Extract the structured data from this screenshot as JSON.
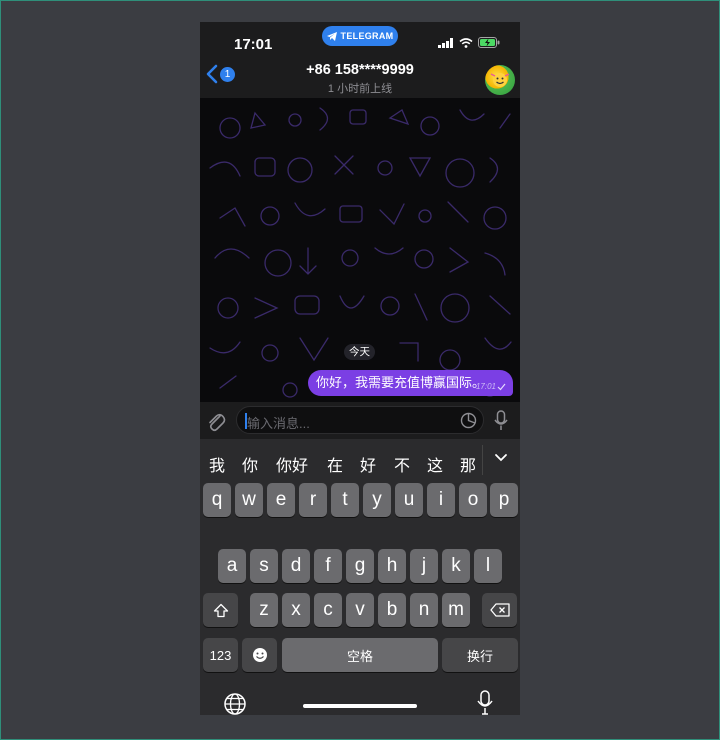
{
  "status_bar": {
    "time": "17:01",
    "app_pill": "TELEGRAM"
  },
  "header": {
    "back_badge": "1",
    "contact_name": "+86 158****9999",
    "contact_status": "1 小时前上线"
  },
  "chat": {
    "date_chip": "今天",
    "messages": [
      {
        "text": "你好，我需要充值博赢国际。",
        "time": "17:01",
        "outgoing": true,
        "status": "sent"
      }
    ]
  },
  "input": {
    "placeholder": "输入消息..."
  },
  "keyboard": {
    "candidates": [
      "我",
      "你",
      "你好",
      "在",
      "好",
      "不",
      "这",
      "那"
    ],
    "row1": [
      "q",
      "w",
      "e",
      "r",
      "t",
      "y",
      "u",
      "i",
      "o",
      "p"
    ],
    "row2": [
      "a",
      "s",
      "d",
      "f",
      "g",
      "h",
      "j",
      "k",
      "l"
    ],
    "row3": [
      "z",
      "x",
      "c",
      "v",
      "b",
      "n",
      "m"
    ],
    "numbers_key": "123",
    "space_key": "空格",
    "return_key": "换行"
  },
  "colors": {
    "accent": "#2f80ed",
    "bubble": "#7b3fe4",
    "background": "#3b3d42"
  }
}
